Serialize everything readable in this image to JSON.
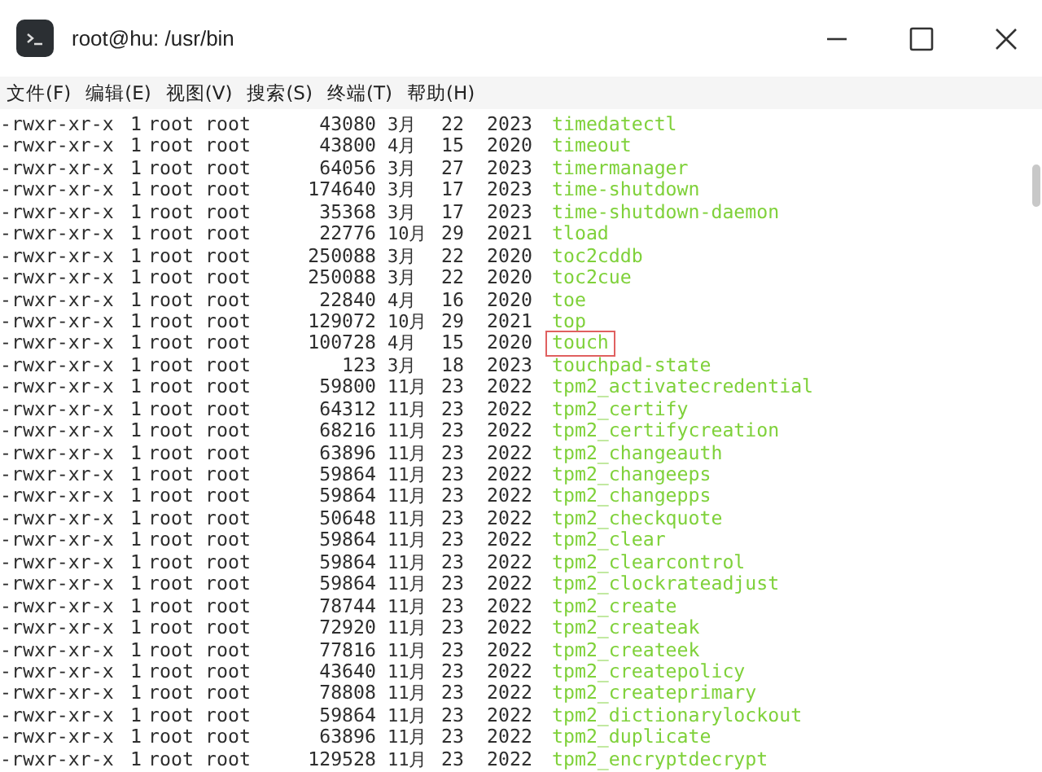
{
  "window": {
    "title": "root@hu: /usr/bin"
  },
  "menu": [
    "文件(F)",
    "编辑(E)",
    "视图(V)",
    "搜索(S)",
    "终端(T)",
    "帮助(H)"
  ],
  "listing": [
    {
      "mode": "-rwxr-xr-x",
      "links": "1",
      "owner": "root",
      "group": "root",
      "size": "43080",
      "month": "3月",
      "day": "22",
      "year": "2023",
      "name": "timedatectl",
      "highlighted": false
    },
    {
      "mode": "-rwxr-xr-x",
      "links": "1",
      "owner": "root",
      "group": "root",
      "size": "43800",
      "month": "4月",
      "day": "15",
      "year": "2020",
      "name": "timeout",
      "highlighted": false
    },
    {
      "mode": "-rwxr-xr-x",
      "links": "1",
      "owner": "root",
      "group": "root",
      "size": "64056",
      "month": "3月",
      "day": "27",
      "year": "2023",
      "name": "timermanager",
      "highlighted": false
    },
    {
      "mode": "-rwxr-xr-x",
      "links": "1",
      "owner": "root",
      "group": "root",
      "size": "174640",
      "month": "3月",
      "day": "17",
      "year": "2023",
      "name": "time-shutdown",
      "highlighted": false
    },
    {
      "mode": "-rwxr-xr-x",
      "links": "1",
      "owner": "root",
      "group": "root",
      "size": "35368",
      "month": "3月",
      "day": "17",
      "year": "2023",
      "name": "time-shutdown-daemon",
      "highlighted": false
    },
    {
      "mode": "-rwxr-xr-x",
      "links": "1",
      "owner": "root",
      "group": "root",
      "size": "22776",
      "month": "10月",
      "day": "29",
      "year": "2021",
      "name": "tload",
      "highlighted": false
    },
    {
      "mode": "-rwxr-xr-x",
      "links": "1",
      "owner": "root",
      "group": "root",
      "size": "250088",
      "month": "3月",
      "day": "22",
      "year": "2020",
      "name": "toc2cddb",
      "highlighted": false
    },
    {
      "mode": "-rwxr-xr-x",
      "links": "1",
      "owner": "root",
      "group": "root",
      "size": "250088",
      "month": "3月",
      "day": "22",
      "year": "2020",
      "name": "toc2cue",
      "highlighted": false
    },
    {
      "mode": "-rwxr-xr-x",
      "links": "1",
      "owner": "root",
      "group": "root",
      "size": "22840",
      "month": "4月",
      "day": "16",
      "year": "2020",
      "name": "toe",
      "highlighted": false
    },
    {
      "mode": "-rwxr-xr-x",
      "links": "1",
      "owner": "root",
      "group": "root",
      "size": "129072",
      "month": "10月",
      "day": "29",
      "year": "2021",
      "name": "top",
      "highlighted": false
    },
    {
      "mode": "-rwxr-xr-x",
      "links": "1",
      "owner": "root",
      "group": "root",
      "size": "100728",
      "month": "4月",
      "day": "15",
      "year": "2020",
      "name": "touch",
      "highlighted": true
    },
    {
      "mode": "-rwxr-xr-x",
      "links": "1",
      "owner": "root",
      "group": "root",
      "size": "123",
      "month": "3月",
      "day": "18",
      "year": "2023",
      "name": "touchpad-state",
      "highlighted": false
    },
    {
      "mode": "-rwxr-xr-x",
      "links": "1",
      "owner": "root",
      "group": "root",
      "size": "59800",
      "month": "11月",
      "day": "23",
      "year": "2022",
      "name": "tpm2_activatecredential",
      "highlighted": false
    },
    {
      "mode": "-rwxr-xr-x",
      "links": "1",
      "owner": "root",
      "group": "root",
      "size": "64312",
      "month": "11月",
      "day": "23",
      "year": "2022",
      "name": "tpm2_certify",
      "highlighted": false
    },
    {
      "mode": "-rwxr-xr-x",
      "links": "1",
      "owner": "root",
      "group": "root",
      "size": "68216",
      "month": "11月",
      "day": "23",
      "year": "2022",
      "name": "tpm2_certifycreation",
      "highlighted": false
    },
    {
      "mode": "-rwxr-xr-x",
      "links": "1",
      "owner": "root",
      "group": "root",
      "size": "63896",
      "month": "11月",
      "day": "23",
      "year": "2022",
      "name": "tpm2_changeauth",
      "highlighted": false
    },
    {
      "mode": "-rwxr-xr-x",
      "links": "1",
      "owner": "root",
      "group": "root",
      "size": "59864",
      "month": "11月",
      "day": "23",
      "year": "2022",
      "name": "tpm2_changeeps",
      "highlighted": false
    },
    {
      "mode": "-rwxr-xr-x",
      "links": "1",
      "owner": "root",
      "group": "root",
      "size": "59864",
      "month": "11月",
      "day": "23",
      "year": "2022",
      "name": "tpm2_changepps",
      "highlighted": false
    },
    {
      "mode": "-rwxr-xr-x",
      "links": "1",
      "owner": "root",
      "group": "root",
      "size": "50648",
      "month": "11月",
      "day": "23",
      "year": "2022",
      "name": "tpm2_checkquote",
      "highlighted": false
    },
    {
      "mode": "-rwxr-xr-x",
      "links": "1",
      "owner": "root",
      "group": "root",
      "size": "59864",
      "month": "11月",
      "day": "23",
      "year": "2022",
      "name": "tpm2_clear",
      "highlighted": false
    },
    {
      "mode": "-rwxr-xr-x",
      "links": "1",
      "owner": "root",
      "group": "root",
      "size": "59864",
      "month": "11月",
      "day": "23",
      "year": "2022",
      "name": "tpm2_clearcontrol",
      "highlighted": false
    },
    {
      "mode": "-rwxr-xr-x",
      "links": "1",
      "owner": "root",
      "group": "root",
      "size": "59864",
      "month": "11月",
      "day": "23",
      "year": "2022",
      "name": "tpm2_clockrateadjust",
      "highlighted": false
    },
    {
      "mode": "-rwxr-xr-x",
      "links": "1",
      "owner": "root",
      "group": "root",
      "size": "78744",
      "month": "11月",
      "day": "23",
      "year": "2022",
      "name": "tpm2_create",
      "highlighted": false
    },
    {
      "mode": "-rwxr-xr-x",
      "links": "1",
      "owner": "root",
      "group": "root",
      "size": "72920",
      "month": "11月",
      "day": "23",
      "year": "2022",
      "name": "tpm2_createak",
      "highlighted": false
    },
    {
      "mode": "-rwxr-xr-x",
      "links": "1",
      "owner": "root",
      "group": "root",
      "size": "77816",
      "month": "11月",
      "day": "23",
      "year": "2022",
      "name": "tpm2_createek",
      "highlighted": false
    },
    {
      "mode": "-rwxr-xr-x",
      "links": "1",
      "owner": "root",
      "group": "root",
      "size": "43640",
      "month": "11月",
      "day": "23",
      "year": "2022",
      "name": "tpm2_createpolicy",
      "highlighted": false
    },
    {
      "mode": "-rwxr-xr-x",
      "links": "1",
      "owner": "root",
      "group": "root",
      "size": "78808",
      "month": "11月",
      "day": "23",
      "year": "2022",
      "name": "tpm2_createprimary",
      "highlighted": false
    },
    {
      "mode": "-rwxr-xr-x",
      "links": "1",
      "owner": "root",
      "group": "root",
      "size": "59864",
      "month": "11月",
      "day": "23",
      "year": "2022",
      "name": "tpm2_dictionarylockout",
      "highlighted": false
    },
    {
      "mode": "-rwxr-xr-x",
      "links": "1",
      "owner": "root",
      "group": "root",
      "size": "63896",
      "month": "11月",
      "day": "23",
      "year": "2022",
      "name": "tpm2_duplicate",
      "highlighted": false
    },
    {
      "mode": "-rwxr-xr-x",
      "links": "1",
      "owner": "root",
      "group": "root",
      "size": "129528",
      "month": "11月",
      "day": "23",
      "year": "2022",
      "name": "tpm2_encryptdecrypt",
      "highlighted": false
    }
  ]
}
